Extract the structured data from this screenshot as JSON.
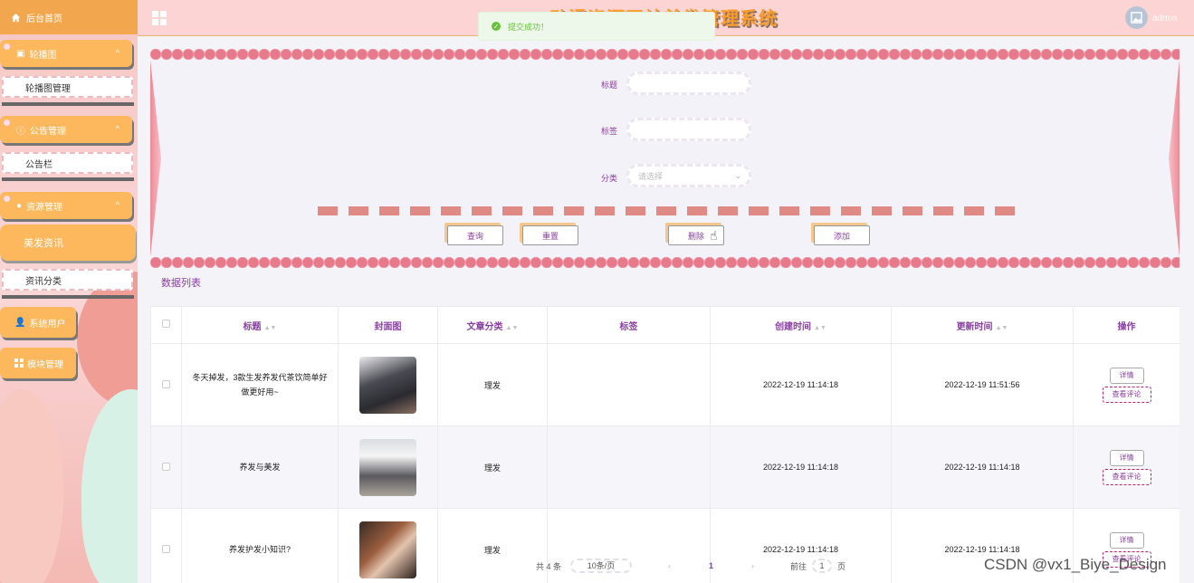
{
  "header": {
    "system_title": "动漫资源网站美发管理系统",
    "user": "admin"
  },
  "toast": {
    "message": "提交成功！"
  },
  "sidebar": {
    "home": "后台首页",
    "groups": [
      {
        "label": "轮播图",
        "sub": "轮播图管理"
      },
      {
        "label": "公告管理",
        "sub": "公告栏"
      },
      {
        "label": "资源管理",
        "active": "美发资讯",
        "sub": "资讯分类"
      }
    ],
    "system_users": "系统用户",
    "module_manage": "模块管理"
  },
  "search": {
    "title_label": "标题",
    "tag_label": "标签",
    "category_label": "分类",
    "category_placeholder": "请选择",
    "buttons": {
      "query": "查询",
      "reset": "重置",
      "delete": "删除",
      "add": "添加"
    }
  },
  "list_title": "数据列表",
  "table": {
    "headers": {
      "title": "标题",
      "cover": "封面图",
      "category": "文章分类",
      "tags": "标签",
      "created": "创建时间",
      "updated": "更新时间",
      "ops": "操作"
    },
    "rows": [
      {
        "title": "冬天掉发，3款生发养发代茶饮简单好做更好用~",
        "category": "理发",
        "tags": "",
        "created": "2022-12-19 11:14:18",
        "updated": "2022-12-19 11:51:56"
      },
      {
        "title": "养发与美发",
        "category": "理发",
        "tags": "",
        "created": "2022-12-19 11:14:18",
        "updated": "2022-12-19 11:14:18"
      },
      {
        "title": "养发护发小知识?",
        "category": "理发",
        "tags": "",
        "created": "2022-12-19 11:14:18",
        "updated": "2022-12-19 11:14:18"
      }
    ],
    "op_detail": "详情",
    "op_comments": "查看评论"
  },
  "pagination": {
    "total": "共 4 条",
    "page_size": "10条/页",
    "current": "1",
    "goto": "前往",
    "goto_value": "1",
    "page_unit": "页",
    "prev": "‹",
    "next": "›"
  },
  "watermark": "CSDN @vx1_Biye_Design"
}
